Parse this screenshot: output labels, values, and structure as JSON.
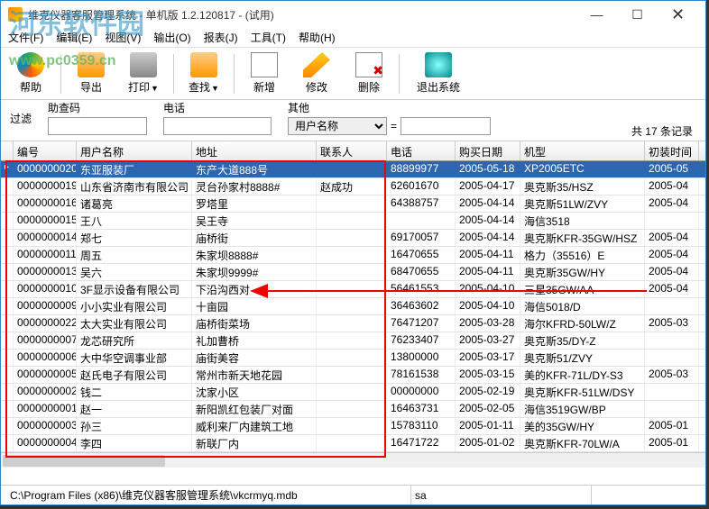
{
  "watermark": {
    "line1": "河东软件园",
    "line2": "www.pc0359.cn"
  },
  "window": {
    "title": "维克仪器客服管理系统 - 单机版 1.2.120817 - (试用)"
  },
  "menu": [
    "文件(F)",
    "编辑(E)",
    "视图(V)",
    "输出(O)",
    "报表(J)",
    "工具(T)",
    "帮助(H)"
  ],
  "toolbar": {
    "help": "帮助",
    "export": "导出",
    "print": "打印",
    "search": "查找",
    "add": "新增",
    "edit": "修改",
    "del": "删除",
    "exit": "退出系统"
  },
  "filter": {
    "label": "过滤",
    "g1": {
      "label": "助查码",
      "value": ""
    },
    "g2": {
      "label": "电话",
      "value": ""
    },
    "g3": {
      "label": "其他",
      "select": "用户名称",
      "input": ""
    },
    "eq": "="
  },
  "reccount": "共 17 条记录",
  "columns": [
    "编号",
    "用户名称",
    "地址",
    "联系人",
    "电话",
    "购买日期",
    "机型",
    "初装时间"
  ],
  "rows": [
    {
      "id": "0000000020",
      "name": "东亚服装厂",
      "addr": "东产大道888号",
      "contact": "",
      "tel": "88899977",
      "date": "2005-05-18",
      "model": "XP2005ETC",
      "inst": "2005-05"
    },
    {
      "id": "0000000019",
      "name": "山东省济南市有限公司",
      "addr": "灵台孙家村8888#",
      "contact": "赵成功",
      "tel": "62601670",
      "date": "2005-04-17",
      "model": "奥克斯35/HSZ",
      "inst": "2005-04"
    },
    {
      "id": "0000000016",
      "name": "诸葛亮",
      "addr": "罗塔里",
      "contact": "",
      "tel": "64388757",
      "date": "2005-04-14",
      "model": "奥克斯51LW/ZVY",
      "inst": "2005-04"
    },
    {
      "id": "0000000015",
      "name": "王八",
      "addr": "吴王寺",
      "contact": "",
      "tel": "",
      "date": "2005-04-14",
      "model": "海信3518",
      "inst": ""
    },
    {
      "id": "0000000014",
      "name": "郑七",
      "addr": "庙桥街",
      "contact": "",
      "tel": "69170057",
      "date": "2005-04-14",
      "model": "奥克斯KFR-35GW/HSZ",
      "inst": "2005-04"
    },
    {
      "id": "0000000011",
      "name": "周五",
      "addr": "朱家坝8888#",
      "contact": "",
      "tel": "16470655",
      "date": "2005-04-11",
      "model": "格力（35516）E",
      "inst": "2005-04"
    },
    {
      "id": "0000000013",
      "name": "吴六",
      "addr": "朱家坝9999#",
      "contact": "",
      "tel": "68470655",
      "date": "2005-04-11",
      "model": "奥克斯35GW/HY",
      "inst": "2005-04"
    },
    {
      "id": "0000000010",
      "name": "3F显示设备有限公司",
      "addr": "下沿沟西对",
      "contact": "",
      "tel": "56461553",
      "date": "2005-04-10",
      "model": "三星35GW/AA",
      "inst": "2005-04"
    },
    {
      "id": "0000000009",
      "name": "小小实业有限公司",
      "addr": "十亩园",
      "contact": "",
      "tel": "36463602",
      "date": "2005-04-10",
      "model": "海信5018/D",
      "inst": ""
    },
    {
      "id": "0000000022",
      "name": "太大实业有限公司",
      "addr": "庙桥街菜场",
      "contact": "",
      "tel": "76471207",
      "date": "2005-03-28",
      "model": "海尔KFRD-50LW/Z",
      "inst": "2005-03"
    },
    {
      "id": "0000000007",
      "name": "龙芯研究所",
      "addr": "礼加曹桥",
      "contact": "",
      "tel": "76233407",
      "date": "2005-03-27",
      "model": "奥克斯35/DY-Z",
      "inst": ""
    },
    {
      "id": "0000000006",
      "name": "大中华空调事业部",
      "addr": "庙街美容",
      "contact": "",
      "tel": "13800000",
      "date": "2005-03-17",
      "model": "奥克斯51/ZVY",
      "inst": ""
    },
    {
      "id": "0000000005",
      "name": "赵氏电子有限公司",
      "addr": "常州市新天地花园",
      "contact": "",
      "tel": "78161538",
      "date": "2005-03-15",
      "model": "美的KFR-71L/DY-S3",
      "inst": "2005-03"
    },
    {
      "id": "0000000002",
      "name": "钱二",
      "addr": "沈家小区",
      "contact": "",
      "tel": "00000000",
      "date": "2005-02-19",
      "model": "奥克斯KFR-51LW/DSY",
      "inst": ""
    },
    {
      "id": "0000000001",
      "name": "赵一",
      "addr": "新阳凯红包装厂对面",
      "contact": "",
      "tel": "16463731",
      "date": "2005-02-05",
      "model": "海信3519GW/BP",
      "inst": ""
    },
    {
      "id": "0000000003",
      "name": "孙三",
      "addr": "威利来厂内建筑工地",
      "contact": "",
      "tel": "15783110",
      "date": "2005-01-11",
      "model": "美的35GW/HY",
      "inst": "2005-01"
    },
    {
      "id": "0000000004",
      "name": "李四",
      "addr": "新联厂内",
      "contact": "",
      "tel": "16471722",
      "date": "2005-01-02",
      "model": "奥克斯KFR-70LW/A",
      "inst": "2005-01"
    }
  ],
  "status": {
    "path": "C:\\Program Files (x86)\\维克仪器客服管理系统\\vkcrmyq.mdb",
    "user": "sa"
  }
}
